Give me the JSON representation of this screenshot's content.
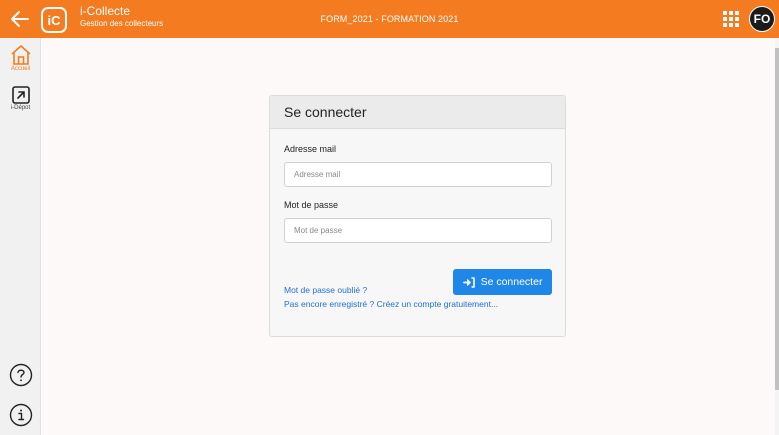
{
  "header": {
    "app_name": "i-Collecte",
    "app_subtitle": "Gestion des collecteurs",
    "logo_text": "iC",
    "form_title": "FORM_2021 - FORMATION 2021",
    "avatar_initials": "FO",
    "color": "#f47b20"
  },
  "sidebar": {
    "items": [
      {
        "label": "Accueil",
        "icon": "home-icon",
        "active": true
      },
      {
        "label": "i-Dépot",
        "icon": "external-link-icon",
        "active": false
      }
    ],
    "bottom": [
      {
        "icon": "help-icon"
      },
      {
        "icon": "info-icon"
      }
    ]
  },
  "login": {
    "title": "Se connecter",
    "email_label": "Adresse mail",
    "email_placeholder": "Adresse mail",
    "password_label": "Mot de passe",
    "password_placeholder": "Mot de passe",
    "submit_label": "Se connecter",
    "forgot_link": "Mot de passe oublié ?",
    "register_link": "Pas encore enregistré ? Créez un compte gratuitement...",
    "button_color": "#1f87e8"
  }
}
